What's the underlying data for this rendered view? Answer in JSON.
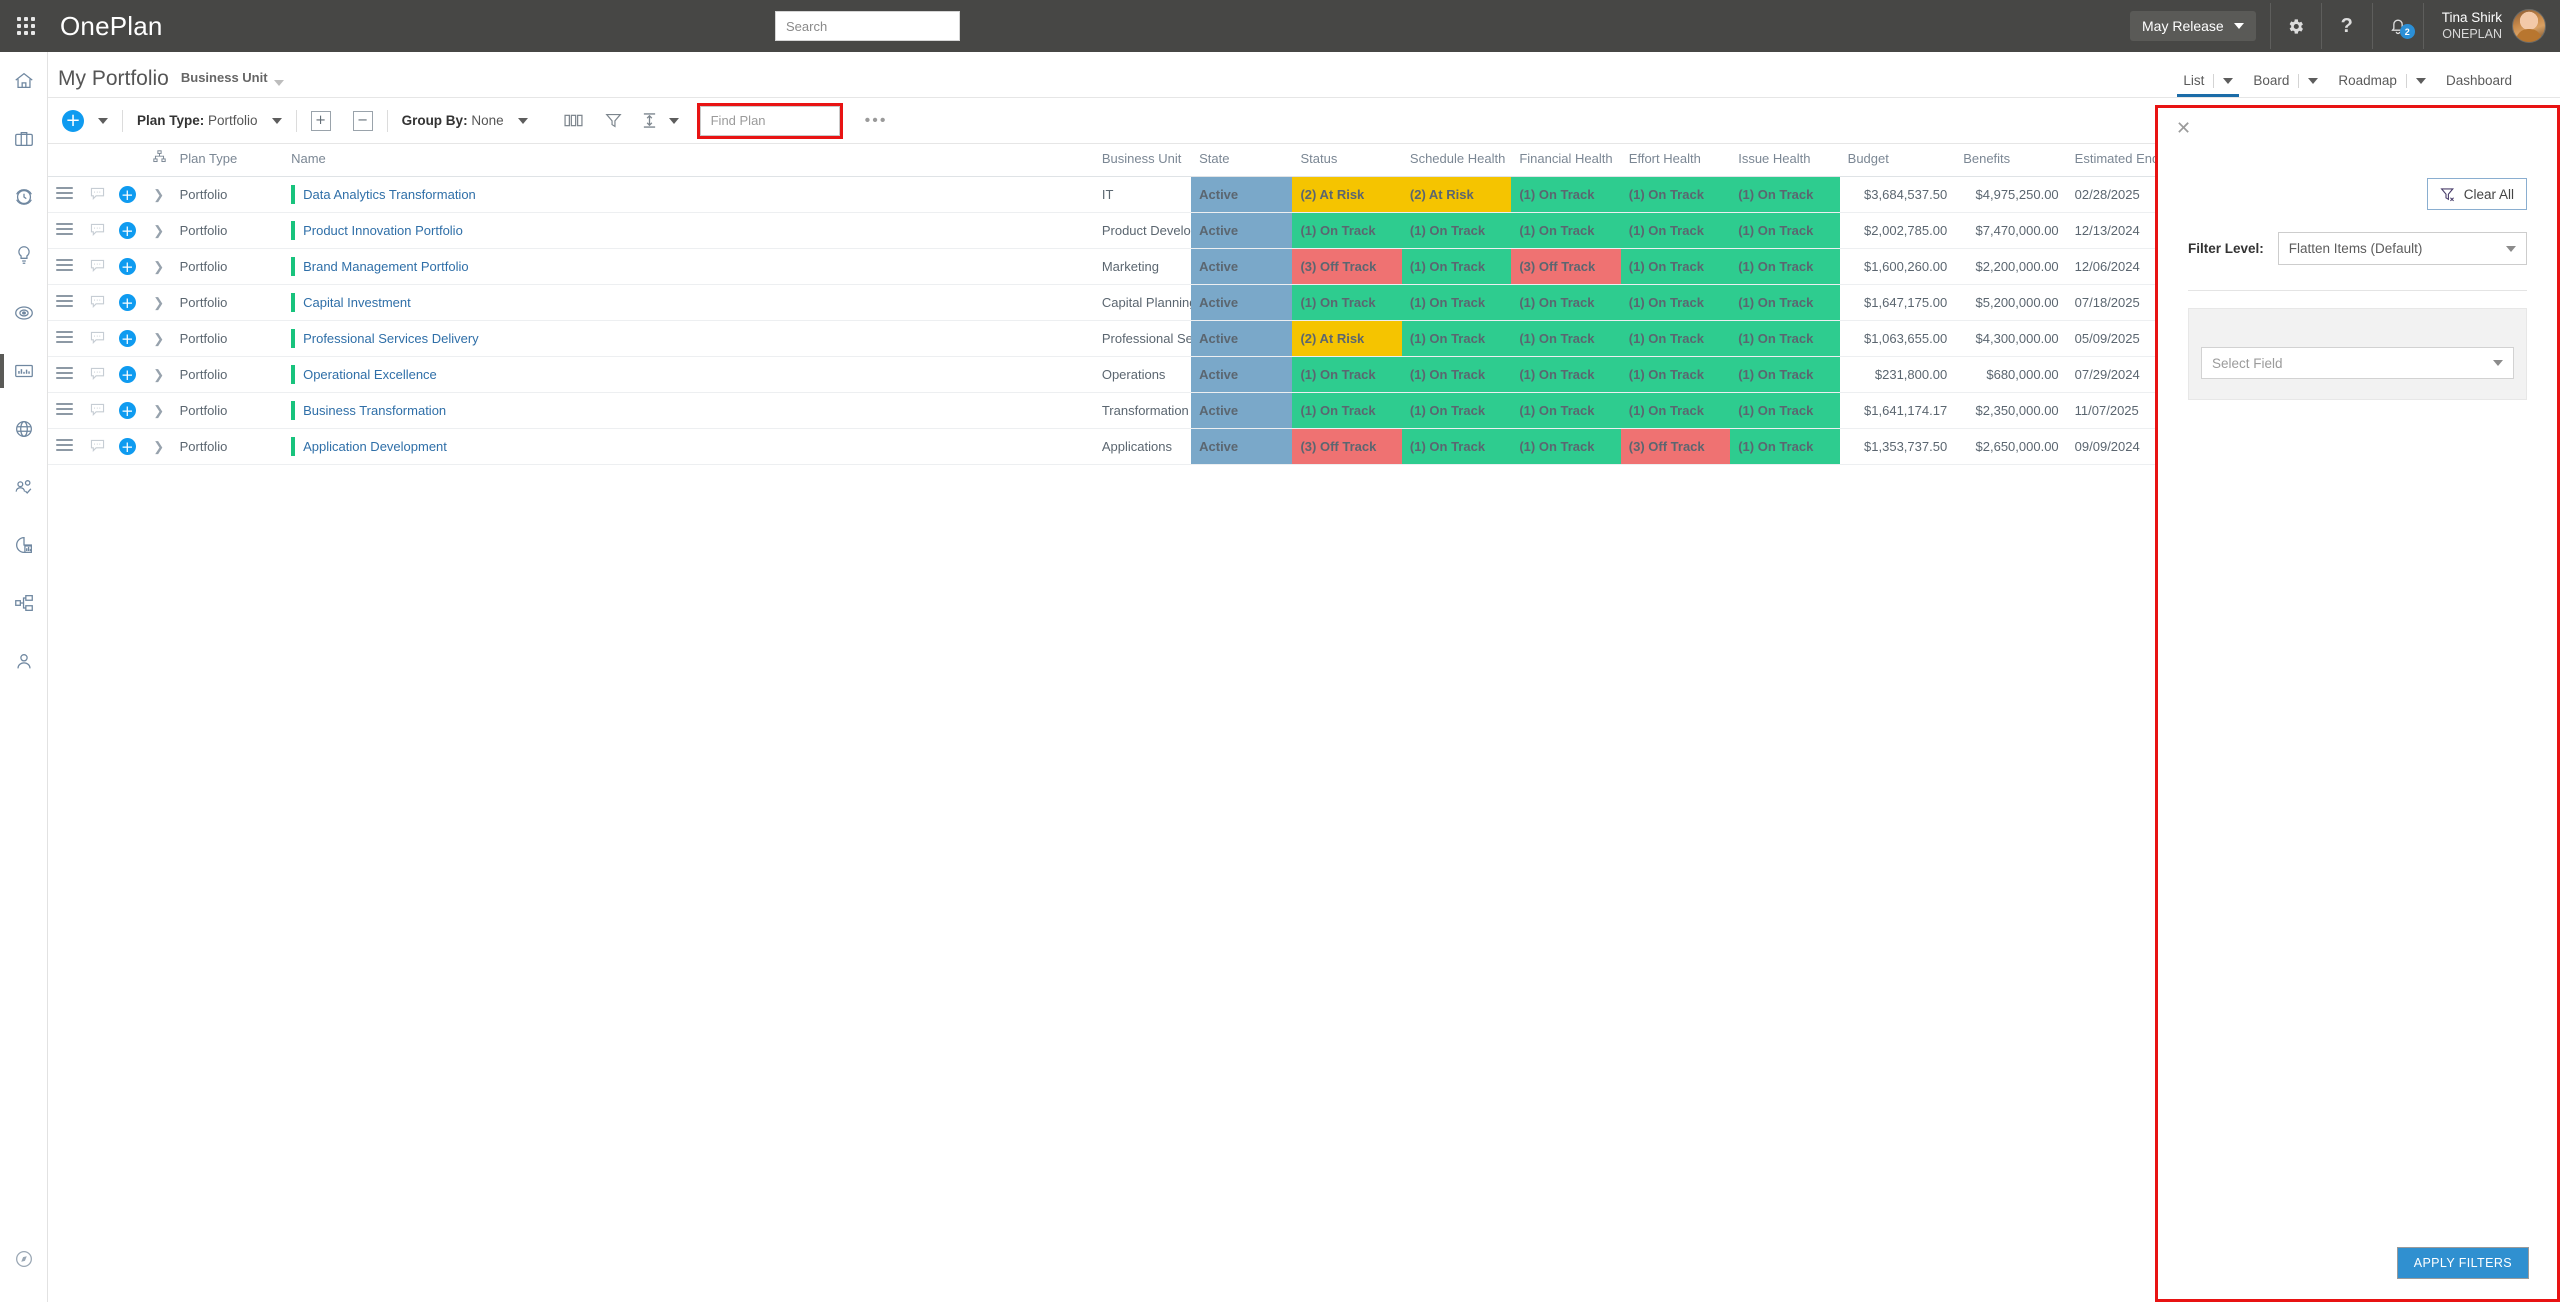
{
  "topbar": {
    "brand": "OnePlan",
    "waffle_icon": "app-grid-icon",
    "search_placeholder": "Search",
    "search_value": "",
    "release_label": "May Release",
    "settings_icon": "gear-icon",
    "help_icon": "question-mark-icon",
    "notifications_icon": "bell-icon",
    "notifications_count": "2",
    "user_name": "Tina Shirk",
    "user_org": "ONEPLAN"
  },
  "rail": {
    "items": [
      {
        "icon": "home-icon",
        "name": "home"
      },
      {
        "icon": "briefcase-icon",
        "name": "portfolio"
      },
      {
        "icon": "clock-icon",
        "name": "timesheet"
      },
      {
        "icon": "lightbulb-icon",
        "name": "ideas"
      },
      {
        "icon": "target-icon",
        "name": "strategy"
      },
      {
        "icon": "bar-chart-icon",
        "name": "my-portfolio",
        "active": true
      },
      {
        "icon": "globe-icon",
        "name": "enterprise"
      },
      {
        "icon": "people-check-icon",
        "name": "resources"
      },
      {
        "icon": "pie-chart-icon",
        "name": "analytics"
      },
      {
        "icon": "org-chart-icon",
        "name": "workflows"
      },
      {
        "icon": "person-icon",
        "name": "admin"
      }
    ],
    "bottom_icon": "compass-icon"
  },
  "pagehead": {
    "title": "My Portfolio",
    "subtitle": "Business Unit",
    "tabs": [
      {
        "label": "List",
        "has_caret": true,
        "active": true
      },
      {
        "label": "Board",
        "has_caret": true,
        "active": false
      },
      {
        "label": "Roadmap",
        "has_caret": true,
        "active": false
      },
      {
        "label": "Dashboard",
        "has_caret": false,
        "active": false
      }
    ],
    "expand_icon": "expand-icon"
  },
  "toolbar": {
    "add_icon": "plus-circle-icon",
    "plan_type_label": "Plan Type:",
    "plan_type_value": "Portfolio",
    "expand_all_icon": "expand-rows-icon",
    "collapse_all_icon": "collapse-rows-icon",
    "group_by_label": "Group By:",
    "group_by_value": "None",
    "columns_icon": "columns-icon",
    "filter_icon": "funnel-icon",
    "sort_icon": "sort-icon",
    "find_placeholder": "Find Plan",
    "find_value": "",
    "more_icon": "ellipsis-icon",
    "highlight_color": "#e81313"
  },
  "grid": {
    "columns": [
      "Plan Type",
      "Name",
      "Business Unit",
      "State",
      "Status",
      "Schedule Health",
      "Financial Health",
      "Effort Health",
      "Issue Health",
      "Budget",
      "Benefits",
      "Estimated End"
    ],
    "hierarchy_icon": "hierarchy-icon",
    "rows": [
      {
        "plan_type": "Portfolio",
        "name": "Data Analytics Transformation",
        "business_unit": "IT",
        "state": "Active",
        "status": "(2) At Risk",
        "status_color": "amber",
        "schedule_health": "(2) At Risk",
        "schedule_color": "amber",
        "financial_health": "(1) On Track",
        "financial_color": "green",
        "effort_health": "(1) On Track",
        "effort_color": "green",
        "issue_health": "(1) On Track",
        "issue_color": "green",
        "budget": "$3,684,537.50",
        "benefits": "$4,975,250.00",
        "estimated_end": "02/28/2025"
      },
      {
        "plan_type": "Portfolio",
        "name": "Product Innovation Portfolio",
        "business_unit": "Product Development",
        "state": "Active",
        "status": "(1) On Track",
        "status_color": "green",
        "schedule_health": "(1) On Track",
        "schedule_color": "green",
        "financial_health": "(1) On Track",
        "financial_color": "green",
        "effort_health": "(1) On Track",
        "effort_color": "green",
        "issue_health": "(1) On Track",
        "issue_color": "green",
        "budget": "$2,002,785.00",
        "benefits": "$7,470,000.00",
        "estimated_end": "12/13/2024"
      },
      {
        "plan_type": "Portfolio",
        "name": "Brand Management Portfolio",
        "business_unit": "Marketing",
        "state": "Active",
        "status": "(3) Off Track",
        "status_color": "red",
        "schedule_health": "(1) On Track",
        "schedule_color": "green",
        "financial_health": "(3) Off Track",
        "financial_color": "red",
        "effort_health": "(1) On Track",
        "effort_color": "green",
        "issue_health": "(1) On Track",
        "issue_color": "green",
        "budget": "$1,600,260.00",
        "benefits": "$2,200,000.00",
        "estimated_end": "12/06/2024"
      },
      {
        "plan_type": "Portfolio",
        "name": "Capital Investment",
        "business_unit": "Capital Planning",
        "state": "Active",
        "status": "(1) On Track",
        "status_color": "green",
        "schedule_health": "(1) On Track",
        "schedule_color": "green",
        "financial_health": "(1) On Track",
        "financial_color": "green",
        "effort_health": "(1) On Track",
        "effort_color": "green",
        "issue_health": "(1) On Track",
        "issue_color": "green",
        "budget": "$1,647,175.00",
        "benefits": "$5,200,000.00",
        "estimated_end": "07/18/2025"
      },
      {
        "plan_type": "Portfolio",
        "name": "Professional Services Delivery",
        "business_unit": "Professional Services",
        "state": "Active",
        "status": "(2) At Risk",
        "status_color": "amber",
        "schedule_health": "(1) On Track",
        "schedule_color": "green",
        "financial_health": "(1) On Track",
        "financial_color": "green",
        "effort_health": "(1) On Track",
        "effort_color": "green",
        "issue_health": "(1) On Track",
        "issue_color": "green",
        "budget": "$1,063,655.00",
        "benefits": "$4,300,000.00",
        "estimated_end": "05/09/2025"
      },
      {
        "plan_type": "Portfolio",
        "name": "Operational Excellence",
        "business_unit": "Operations",
        "state": "Active",
        "status": "(1) On Track",
        "status_color": "green",
        "schedule_health": "(1) On Track",
        "schedule_color": "green",
        "financial_health": "(1) On Track",
        "financial_color": "green",
        "effort_health": "(1) On Track",
        "effort_color": "green",
        "issue_health": "(1) On Track",
        "issue_color": "green",
        "budget": "$231,800.00",
        "benefits": "$680,000.00",
        "estimated_end": "07/29/2024"
      },
      {
        "plan_type": "Portfolio",
        "name": "Business Transformation",
        "business_unit": "Transformation",
        "state": "Active",
        "status": "(1) On Track",
        "status_color": "green",
        "schedule_health": "(1) On Track",
        "schedule_color": "green",
        "financial_health": "(1) On Track",
        "financial_color": "green",
        "effort_health": "(1) On Track",
        "effort_color": "green",
        "issue_health": "(1) On Track",
        "issue_color": "green",
        "budget": "$1,641,174.17",
        "benefits": "$2,350,000.00",
        "estimated_end": "11/07/2025"
      },
      {
        "plan_type": "Portfolio",
        "name": "Application Development",
        "business_unit": "Applications",
        "state": "Active",
        "status": "(3) Off Track",
        "status_color": "red",
        "schedule_health": "(1) On Track",
        "schedule_color": "green",
        "financial_health": "(1) On Track",
        "financial_color": "green",
        "effort_health": "(3) Off Track",
        "effort_color": "red",
        "issue_health": "(1) On Track",
        "issue_color": "green",
        "budget": "$1,353,737.50",
        "benefits": "$2,650,000.00",
        "estimated_end": "09/09/2024"
      }
    ]
  },
  "filter_panel": {
    "close_icon": "close-icon",
    "clear_all_label": "Clear All",
    "clear_all_icon": "funnel-clear-icon",
    "filter_level_label": "Filter Level:",
    "filter_level_value": "Flatten Items (Default)",
    "select_field_placeholder": "Select Field",
    "apply_label": "APPLY FILTERS",
    "highlight_color": "#e81313",
    "accent_color": "#3090d0"
  },
  "colors": {
    "green": "#2ecc8f",
    "amber": "#f5c400",
    "red": "#ef7272",
    "state_blue": "#7aa8c9",
    "link_blue": "#2f6fa8",
    "topbar": "#474745"
  }
}
